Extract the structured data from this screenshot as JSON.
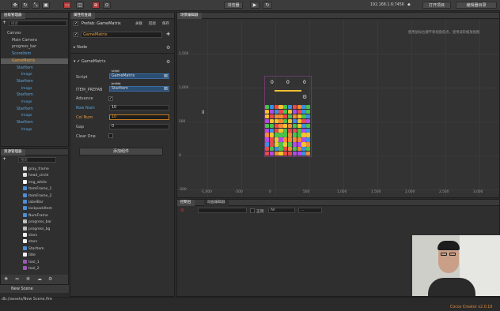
{
  "toolbar": {
    "gizmo_mode": "",
    "preview_label": "浏览器",
    "ip": "192.168.1.6:7456",
    "wifi_glyph": "◆",
    "open_project_label": "打开项目",
    "open_editor_label": "编辑器目录"
  },
  "hierarchy": {
    "tab_label": "层级管理器",
    "search_placeholder": "搜索",
    "items": [
      {
        "label": "Canvas",
        "cls": "",
        "indent": 0
      },
      {
        "label": "Main Camera",
        "cls": "",
        "indent": 1
      },
      {
        "label": "progress_bar",
        "cls": "",
        "indent": 1
      },
      {
        "label": "ScoreItem",
        "cls": "blue",
        "indent": 1
      },
      {
        "label": "GameMatrix",
        "cls": "blue sel",
        "indent": 1
      },
      {
        "label": "StarItem",
        "cls": "blue",
        "indent": 2
      },
      {
        "label": "Image",
        "cls": "blue",
        "indent": 3
      },
      {
        "label": "StarItem",
        "cls": "blue",
        "indent": 2
      },
      {
        "label": "Image",
        "cls": "blue",
        "indent": 3
      },
      {
        "label": "StarItem",
        "cls": "blue",
        "indent": 2
      },
      {
        "label": "Image",
        "cls": "blue",
        "indent": 3
      },
      {
        "label": "StarItem",
        "cls": "blue",
        "indent": 2
      },
      {
        "label": "Image",
        "cls": "blue",
        "indent": 3
      },
      {
        "label": "StarItem",
        "cls": "blue",
        "indent": 2
      },
      {
        "label": "Image",
        "cls": "blue",
        "indent": 3
      }
    ]
  },
  "assets": {
    "tab_label": "资源管理器",
    "search_placeholder": "搜索",
    "items": [
      {
        "label": "gray_frame",
        "color": "#e0e0e0"
      },
      {
        "label": "head_circle",
        "color": "#e0e0e0"
      },
      {
        "label": "img_white",
        "color": "#ffffff"
      },
      {
        "label": "ItemFrame_1",
        "color": "#4c8fd6"
      },
      {
        "label": "ItemFrame_2",
        "color": "#4c8fd6"
      },
      {
        "label": "labelBar",
        "color": "#4c8fd6"
      },
      {
        "label": "lockpackItem",
        "color": "#4c8fd6"
      },
      {
        "label": "NumFrame",
        "color": "#4c8fd6"
      },
      {
        "label": "progress_bar",
        "color": "#bfbfbf"
      },
      {
        "label": "progress_bg",
        "color": "#bfbfbf"
      },
      {
        "label": "stars",
        "color": "#f2f2f2"
      },
      {
        "label": "stars",
        "color": "#f2f2f2"
      },
      {
        "label": "StarItem",
        "color": "#4c8fd6"
      },
      {
        "label": "title",
        "color": "#f2f2f2"
      },
      {
        "label": "tool_1",
        "color": "#9b59b6"
      },
      {
        "label": "tool_2",
        "color": "#9b59b6"
      }
    ],
    "new_scene_label": "New Scene"
  },
  "inspector": {
    "tab_label": "属性检查器",
    "prefab_label": "Prefab: GameMatrix",
    "prefab_btns": [
      "关联",
      "回退",
      "保存"
    ],
    "node_name": "GameMatrix",
    "node_section": "Node",
    "component_name": "GameMatrix",
    "props": {
      "script_label": "Script",
      "script_value": "GameMatrix",
      "script_tag": "script",
      "item_prefab_label": "ITEM_PREFAB",
      "item_prefab_value": "StarItem",
      "item_prefab_tag": "prefab",
      "advance_label": "Advance",
      "row_label": "Row Num",
      "row_value": "10",
      "col_label": "Col Num",
      "col_value": "10",
      "gap_label": "Gap",
      "gap_value": "0",
      "clear_label": "Clear One"
    },
    "add_component_label": "添加组件"
  },
  "scene": {
    "tab_label": "场景编辑器",
    "hint": "使用鼠标右键平移视窗焦点，使用滚轮缩放视图",
    "y_ticks": [
      "1,500",
      "1,000",
      "500",
      "0",
      "-500"
    ],
    "x_ticks": [
      "-1,000",
      "-500",
      "0",
      "500",
      "1,000",
      "1,500",
      "2,000",
      "2,500",
      "3,000"
    ],
    "scores": [
      "0",
      "0",
      "0"
    ]
  },
  "console": {
    "tab1": "控制台",
    "tab2": "动画编辑器",
    "regex_label": "正则",
    "filter_value": "All",
    "level_value": "..."
  },
  "statusbar": {
    "path": "db://assets/New Scene.fire",
    "version": "Cocos Creator v2.0.10"
  },
  "colors": {
    "accent": "#5aa7e0",
    "selected": "#f0a030",
    "panel": "#2f2f2f"
  }
}
